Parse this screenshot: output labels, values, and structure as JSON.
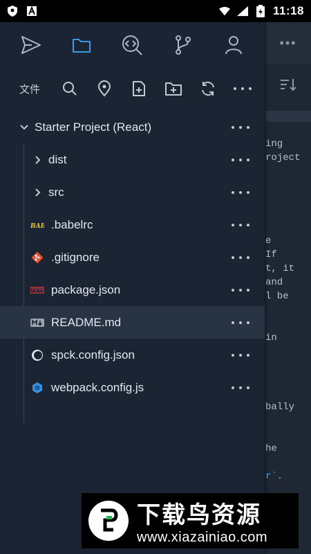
{
  "status_bar": {
    "time": "11:18",
    "left_icons": [
      "shield-icon",
      "a-icon"
    ],
    "right_icons": [
      "wifi-icon",
      "signal-icon",
      "battery-icon"
    ]
  },
  "top_nav": {
    "items": [
      "send-icon",
      "folder-icon",
      "search-code-icon",
      "git-branch-icon",
      "user-icon"
    ],
    "active": "folder-icon",
    "active_color": "#3b9be8"
  },
  "toolbar": {
    "label": "文件",
    "buttons": [
      "search-icon",
      "location-icon",
      "new-file-icon",
      "new-folder-icon",
      "refresh-icon",
      "more-icon"
    ]
  },
  "tree": {
    "project": "Starter Project (React)",
    "items": [
      {
        "label": "dist",
        "type": "folder"
      },
      {
        "label": "src",
        "type": "folder"
      },
      {
        "label": ".babelrc",
        "type": "file",
        "icon": "babel-icon"
      },
      {
        "label": ".gitignore",
        "type": "file",
        "icon": "git-icon"
      },
      {
        "label": "package.json",
        "type": "file",
        "icon": "npm-icon"
      },
      {
        "label": "README.md",
        "type": "file",
        "icon": "markdown-icon",
        "selected": true
      },
      {
        "label": "spck.config.json",
        "type": "file",
        "icon": "spck-icon"
      },
      {
        "label": "webpack.config.js",
        "type": "file",
        "icon": "webpack-icon"
      }
    ]
  },
  "editor_bg": {
    "lines": [
      "ing",
      "roject",
      "e",
      " If",
      "t, it",
      " and",
      "l be",
      "in",
      "bally",
      "he",
      "r`."
    ]
  },
  "watermark": {
    "title": "下载鸟资源",
    "url": "www.xiazainiao.com"
  }
}
